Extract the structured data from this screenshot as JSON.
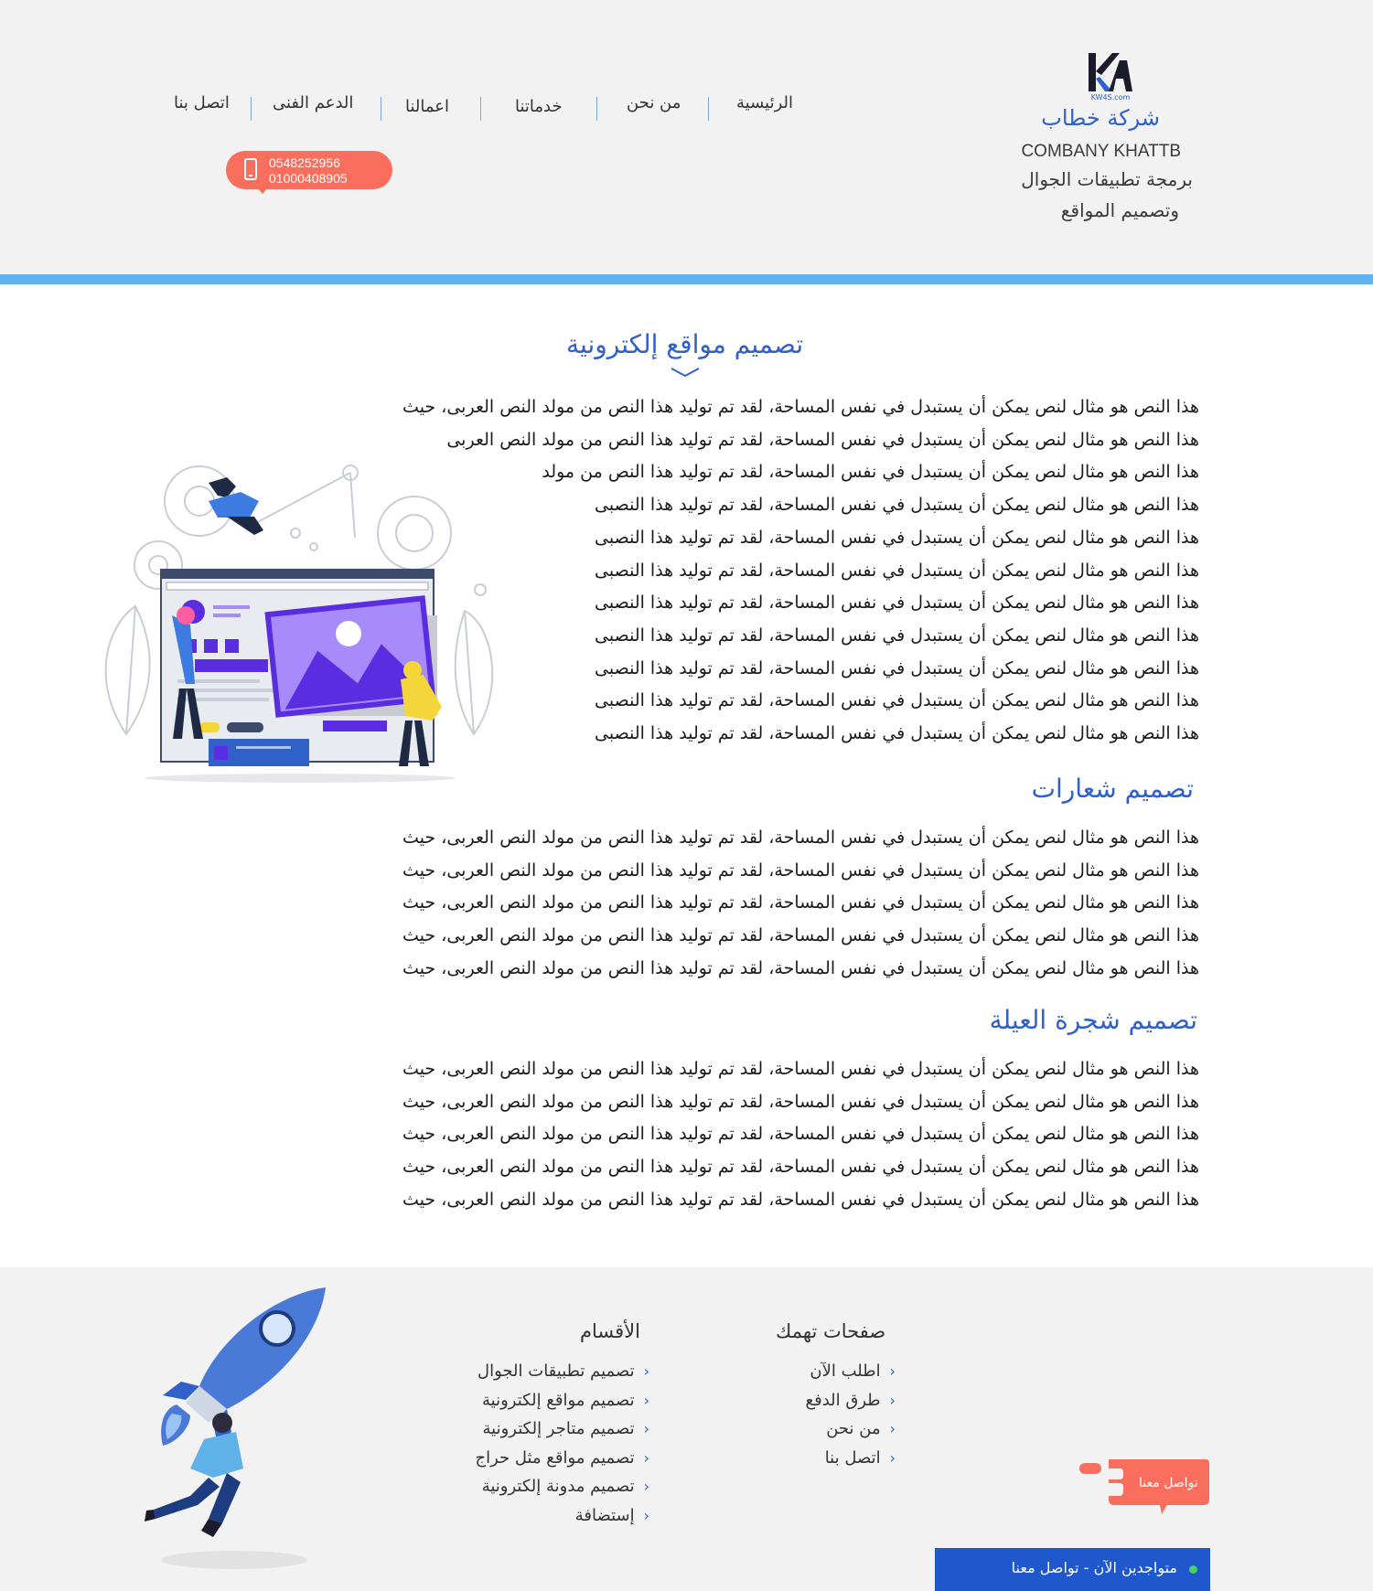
{
  "header": {
    "logo_text": "KW4S.com",
    "brand_name": "شركة خطاب",
    "brand_name_en": "COMBANY KHATTB",
    "tagline_line1": "برمجة تطبيقات الجوال",
    "tagline_line2": "وتصميم المواقع",
    "phone1": "0548252956",
    "phone2": "01000408905"
  },
  "nav": {
    "home": "الرئيسية",
    "about": "من نحن",
    "services": "خدماتنا",
    "works": "اعمالنا",
    "support": "الدعم الفنى",
    "contact": "اتصل بنا"
  },
  "sections": [
    {
      "title": "تصميم مواقع إلكترونية",
      "lines": [
        "هذا النص هو مثال لنص يمكن أن يستبدل في نفس المساحة، لقد تم توليد هذا النص من مولد النص العربى، حيث",
        "هذا النص هو مثال لنص يمكن أن يستبدل في نفس المساحة، لقد تم توليد هذا النص من مولد النص العربى",
        "هذا النص هو مثال لنص يمكن أن يستبدل في نفس المساحة، لقد تم توليد هذا النص من مولد",
        "هذا النص هو مثال لنص يمكن أن يستبدل في نفس المساحة، لقد تم توليد هذا النصبى",
        "هذا النص هو مثال لنص يمكن أن يستبدل في نفس المساحة، لقد تم توليد هذا النصبى",
        "هذا النص هو مثال لنص يمكن أن يستبدل في نفس المساحة، لقد تم توليد هذا النصبى",
        "هذا النص هو مثال لنص يمكن أن يستبدل في نفس المساحة، لقد تم توليد هذا النصبى",
        "هذا النص هو مثال لنص يمكن أن يستبدل في نفس المساحة، لقد تم توليد هذا النصبى",
        "هذا النص هو مثال لنص يمكن أن يستبدل في نفس المساحة، لقد تم توليد هذا النصبى",
        "هذا النص هو مثال لنص يمكن أن يستبدل في نفس المساحة، لقد تم توليد هذا النصبى",
        "هذا النص هو مثال لنص يمكن أن يستبدل في نفس المساحة، لقد تم توليد هذا النصبى"
      ]
    },
    {
      "title": "تصميم شعارات",
      "lines": [
        "هذا النص هو مثال لنص يمكن أن يستبدل في نفس المساحة، لقد تم توليد هذا النص من مولد النص العربى، حيث",
        "هذا النص هو مثال لنص يمكن أن يستبدل في نفس المساحة، لقد تم توليد هذا النص من مولد النص العربى، حيث",
        "هذا النص هو مثال لنص يمكن أن يستبدل في نفس المساحة، لقد تم توليد هذا النص من مولد النص العربى، حيث",
        "هذا النص هو مثال لنص يمكن أن يستبدل في نفس المساحة، لقد تم توليد هذا النص من مولد النص العربى، حيث",
        "هذا النص هو مثال لنص يمكن أن يستبدل في نفس المساحة، لقد تم توليد هذا النص من مولد النص العربى، حيث"
      ]
    },
    {
      "title": "تصميم شجرة العيلة",
      "lines": [
        "هذا النص هو مثال لنص يمكن أن يستبدل في نفس المساحة، لقد تم توليد هذا النص من مولد النص العربى، حيث",
        "هذا النص هو مثال لنص يمكن أن يستبدل في نفس المساحة، لقد تم توليد هذا النص من مولد النص العربى، حيث",
        "هذا النص هو مثال لنص يمكن أن يستبدل في نفس المساحة، لقد تم توليد هذا النص من مولد النص العربى، حيث",
        "هذا النص هو مثال لنص يمكن أن يستبدل في نفس المساحة، لقد تم توليد هذا النص من مولد النص العربى، حيث",
        "هذا النص هو مثال لنص يمكن أن يستبدل في نفس المساحة، لقد تم توليد هذا النص من مولد النص العربى، حيث"
      ]
    }
  ],
  "footer": {
    "pages_title": "صفحات تهمك",
    "pages": [
      "اطلب الآن",
      "طرق الدفع",
      "من نحن",
      "اتصل بنا"
    ],
    "categories_title": "الأقسام",
    "categories": [
      "تصميم تطبيقات الجوال",
      "تصميم مواقع إلكترونية",
      "تصميم متاجر إلكترونية",
      "تصميم مواقع مثل حراج",
      "تصميم مدونة إلكترونية",
      "إستضافة"
    ],
    "contact_bubble": "تواصل معنا",
    "online_bar": "متواجدين الآن - تواصل معنا"
  },
  "colors": {
    "accent_blue": "#2f61c9",
    "header_bar": "#64b1f2",
    "phone_pill": "#fa6e5d",
    "online_bar": "#1f57cc",
    "online_dot": "#46d360",
    "panel_bg": "#f2f2f2"
  },
  "icons": [
    "kw4s-logo-icon",
    "phone-icon",
    "chevron-down-icon",
    "chevron-left-icon",
    "online-dot-icon",
    "web-design-illustration",
    "rocket-illustration",
    "chat-bubble-icon"
  ]
}
